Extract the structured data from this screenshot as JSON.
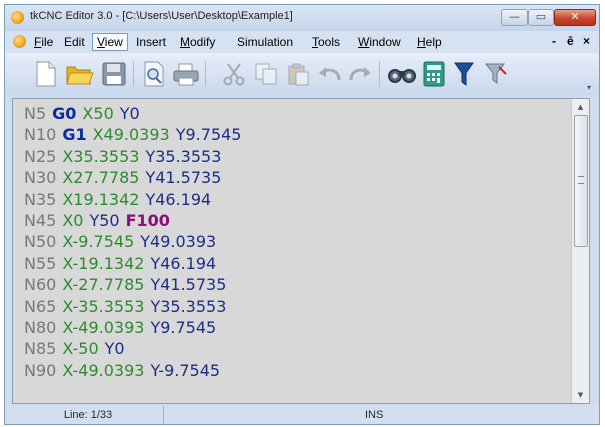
{
  "window": {
    "title": "tkCNC Editor 3.0 - [C:\\Users\\User\\Desktop\\Example1]",
    "min_glyph": "—",
    "max_glyph": "▭",
    "close_glyph": "✕"
  },
  "menu": {
    "items": [
      {
        "label": "File",
        "accel": "F",
        "rest": "ile"
      },
      {
        "label": "Edit",
        "accel": "",
        "rest": "Edit"
      },
      {
        "label": "View",
        "accel": "V",
        "rest": "iew",
        "active": true
      },
      {
        "label": "Insert",
        "accel": "",
        "rest": "Insert"
      },
      {
        "label": "Modify",
        "accel": "M",
        "rest": "odify"
      },
      {
        "label": "Simulation",
        "accel": "",
        "rest": "Simulation"
      },
      {
        "label": "Tools",
        "accel": "T",
        "rest": "ools"
      },
      {
        "label": "Window",
        "accel": "W",
        "rest": "indow"
      },
      {
        "label": "Help",
        "accel": "H",
        "rest": "elp"
      }
    ],
    "mdi_min": "-",
    "mdi_restore": "ē",
    "mdi_close": "×"
  },
  "toolbar": {
    "buttons": [
      "new-file-icon",
      "open-folder-icon",
      "save-icon",
      "print-preview-icon",
      "print-icon",
      "cut-icon",
      "copy-icon",
      "paste-icon",
      "undo-icon",
      "redo-icon",
      "find-binoculars-icon",
      "calculator-icon",
      "funnel-filter-icon",
      "funnel-clear-icon"
    ],
    "grip": "▾"
  },
  "colors": {
    "seq": "#787878",
    "x": "#2f8a2f",
    "y": "#1c2e86",
    "g": "#0a2aa0",
    "f": "#8a1078"
  },
  "code": [
    [
      {
        "t": "N5",
        "k": "seq"
      },
      {
        "t": "G0",
        "k": "g"
      },
      {
        "t": "X50",
        "k": "x"
      },
      {
        "t": "Y0",
        "k": "y"
      }
    ],
    [
      {
        "t": "N10",
        "k": "seq"
      },
      {
        "t": "G1",
        "k": "g"
      },
      {
        "t": "X49.0393",
        "k": "x"
      },
      {
        "t": "Y9.7545",
        "k": "y"
      }
    ],
    [
      {
        "t": "N25",
        "k": "seq"
      },
      {
        "t": "X35.3553",
        "k": "x"
      },
      {
        "t": "Y35.3553",
        "k": "y"
      }
    ],
    [
      {
        "t": "N30",
        "k": "seq"
      },
      {
        "t": "X27.7785",
        "k": "x"
      },
      {
        "t": "Y41.5735",
        "k": "y"
      }
    ],
    [
      {
        "t": "N35",
        "k": "seq"
      },
      {
        "t": "X19.1342",
        "k": "x"
      },
      {
        "t": "Y46.194",
        "k": "y"
      }
    ],
    [
      {
        "t": "N45",
        "k": "seq"
      },
      {
        "t": "X0",
        "k": "x"
      },
      {
        "t": "Y50",
        "k": "y"
      },
      {
        "t": "F100",
        "k": "f"
      }
    ],
    [
      {
        "t": "N50",
        "k": "seq"
      },
      {
        "t": "X-9.7545",
        "k": "x"
      },
      {
        "t": "Y49.0393",
        "k": "y"
      }
    ],
    [
      {
        "t": "N55",
        "k": "seq"
      },
      {
        "t": "X-19.1342",
        "k": "x"
      },
      {
        "t": "Y46.194",
        "k": "y"
      }
    ],
    [
      {
        "t": "N60",
        "k": "seq"
      },
      {
        "t": "X-27.7785",
        "k": "x"
      },
      {
        "t": "Y41.5735",
        "k": "y"
      }
    ],
    [
      {
        "t": "N65",
        "k": "seq"
      },
      {
        "t": "X-35.3553",
        "k": "x"
      },
      {
        "t": "Y35.3553",
        "k": "y"
      }
    ],
    [
      {
        "t": "N80",
        "k": "seq"
      },
      {
        "t": "X-49.0393",
        "k": "x"
      },
      {
        "t": "Y9.7545",
        "k": "y"
      }
    ],
    [
      {
        "t": "N85",
        "k": "seq"
      },
      {
        "t": "X-50",
        "k": "x"
      },
      {
        "t": "Y0",
        "k": "y"
      }
    ],
    [
      {
        "t": "N90",
        "k": "seq"
      },
      {
        "t": "X-49.0393",
        "k": "x"
      },
      {
        "t": "Y-9.7545",
        "k": "y"
      }
    ]
  ],
  "scrollbar": {
    "up": "▲",
    "down": "▼"
  },
  "status": {
    "line": "Line: 1/33",
    "mode": "INS"
  }
}
